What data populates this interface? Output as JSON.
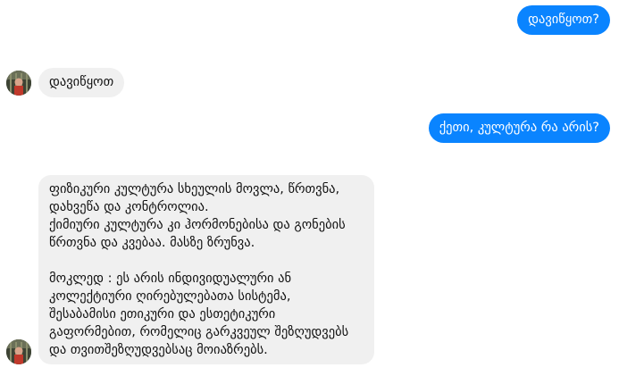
{
  "messages": {
    "m1_out": "დავიწყოთ?",
    "m2_in": "დავიწყოთ",
    "m3_out": "ქეთი, კულტურა რა არის?",
    "m4_in_lines": [
      "ფიზიკური კულტურა სხეულის მოვლა, წრთვნა,",
      "დახვეწა და კონტროლია.",
      "ქიმიური კულტურა კი ჰორმონებისა და გონების",
      "წრთვნა და კვებაა. მასზე ზრუნვა.",
      "",
      "მოკლედ : ეს არის ინდივიდუალური ან",
      "კოლექტიური ღირებულებათა სისტემა,",
      "შესაბამისი ეთიკური და ესთეტიკური",
      "გაფორმებით, რომელიც გარკვეულ შეზღუდვებს",
      "და თვითშეზღუდვებსაც მოიაზრებს."
    ]
  },
  "colors": {
    "outgoing_bubble": "#0a84ff",
    "incoming_bubble": "#f0f0f0"
  },
  "icons": {
    "avatar": "contact-avatar-photo"
  }
}
